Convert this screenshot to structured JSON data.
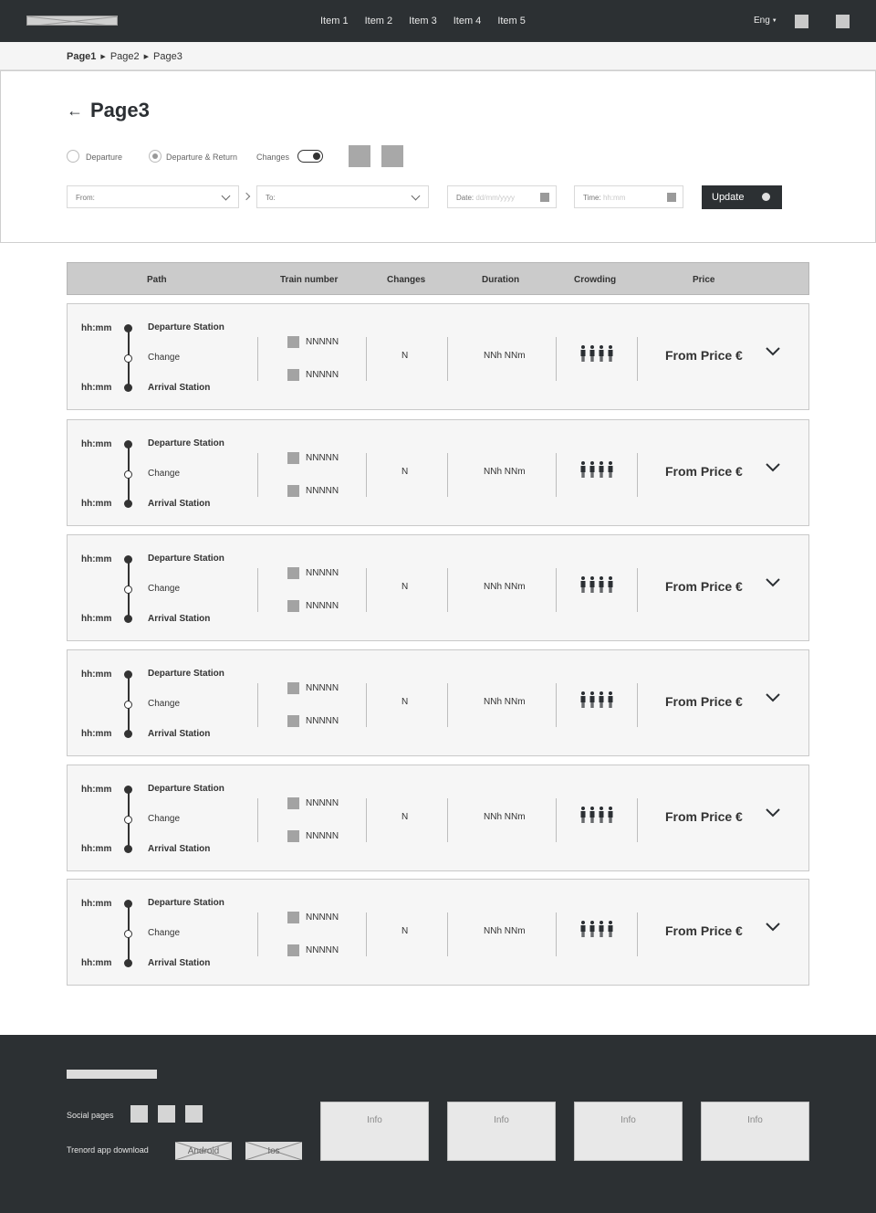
{
  "nav": {
    "items": [
      "Item 1",
      "Item 2",
      "Item 3",
      "Item 4",
      "Item 5"
    ],
    "language": "Eng",
    "icons": [
      "user-icon",
      "menu-icon"
    ]
  },
  "breadcrumb": [
    "Page1",
    "Page2",
    "Page3"
  ],
  "search": {
    "title": "Page3",
    "options": {
      "departure": "Departure",
      "departure_return": "Departure & Return",
      "selected": "departure_return",
      "changes": "Changes",
      "changes_enabled": true
    },
    "from_label": "From:",
    "to_label": "To:",
    "date_label": "Date:",
    "date_placeholder": "dd/mm/yyyy",
    "time_label": "Time:",
    "time_placeholder": "hh:mm",
    "update_label": "Update"
  },
  "table": {
    "headers": {
      "path": "Path",
      "train": "Train number",
      "changes": "Changes",
      "duration": "Duration",
      "crowding": "Crowding",
      "price": "Price"
    },
    "rows": [
      {
        "dep_time": "hh:mm",
        "arr_time": "hh:mm",
        "departure": "Departure Station",
        "change": "Change",
        "arrival": "Arrival Station",
        "train1": "NNNNN",
        "train2": "NNNNN",
        "changes": "N",
        "duration": "NNh NNm",
        "price": "From Price €"
      },
      {
        "dep_time": "hh:mm",
        "arr_time": "hh:mm",
        "departure": "Departure Station",
        "change": "Change",
        "arrival": "Arrival Station",
        "train1": "NNNNN",
        "train2": "NNNNN",
        "changes": "N",
        "duration": "NNh NNm",
        "price": "From Price €"
      },
      {
        "dep_time": "hh:mm",
        "arr_time": "hh:mm",
        "departure": "Departure Station",
        "change": "Change",
        "arrival": "Arrival Station",
        "train1": "NNNNN",
        "train2": "NNNNN",
        "changes": "N",
        "duration": "NNh NNm",
        "price": "From Price €"
      },
      {
        "dep_time": "hh:mm",
        "arr_time": "hh:mm",
        "departure": "Departure Station",
        "change": "Change",
        "arrival": "Arrival Station",
        "train1": "NNNNN",
        "train2": "NNNNN",
        "changes": "N",
        "duration": "NNh NNm",
        "price": "From Price €"
      },
      {
        "dep_time": "hh:mm",
        "arr_time": "hh:mm",
        "departure": "Departure Station",
        "change": "Change",
        "arrival": "Arrival Station",
        "train1": "NNNNN",
        "train2": "NNNNN",
        "changes": "N",
        "duration": "NNh NNm",
        "price": "From Price €"
      },
      {
        "dep_time": "hh:mm",
        "arr_time": "hh:mm",
        "departure": "Departure Station",
        "change": "Change",
        "arrival": "Arrival Station",
        "train1": "NNNNN",
        "train2": "NNNNN",
        "changes": "N",
        "duration": "NNh NNm",
        "price": "From Price €"
      }
    ]
  },
  "footer": {
    "social_label": "Social pages",
    "app_label": "Trenord app download",
    "stores": [
      "Android",
      "Ios"
    ],
    "info": [
      "Info",
      "Info",
      "Info",
      "Info"
    ]
  },
  "colors": {
    "dark": "#2c3033",
    "header_row": "#cbcbcb",
    "row_bg": "#f6f6f6"
  }
}
